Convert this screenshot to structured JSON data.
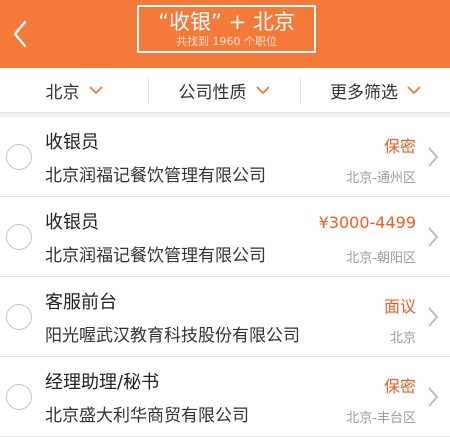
{
  "header": {
    "title": "“收银” + 北京",
    "subtitle": "共找到 1960 个职位",
    "back_icon": "back-chevron-icon",
    "bg_color": "#f47a3a"
  },
  "filters": [
    {
      "label": "北京"
    },
    {
      "label": "公司性质"
    },
    {
      "label": "更多筛选"
    }
  ],
  "jobs": [
    {
      "title": "收银员",
      "company": "北京润福记餐饮管理有限公司",
      "salary": "保密",
      "location": "北京-通州区"
    },
    {
      "title": "收银员",
      "company": "北京润福记餐饮管理有限公司",
      "salary": "¥3000-4499",
      "location": "北京-朝阳区"
    },
    {
      "title": "客服前台",
      "company": "阳光喔武汉教育科技股份有限公司",
      "salary": "面议",
      "location": "北京"
    },
    {
      "title": "经理助理/秘书",
      "company": "北京盛大利华商贸有限公司",
      "salary": "保密",
      "location": "北京-丰台区"
    }
  ],
  "colors": {
    "accent": "#f47a3a",
    "salary": "#f25c22"
  }
}
